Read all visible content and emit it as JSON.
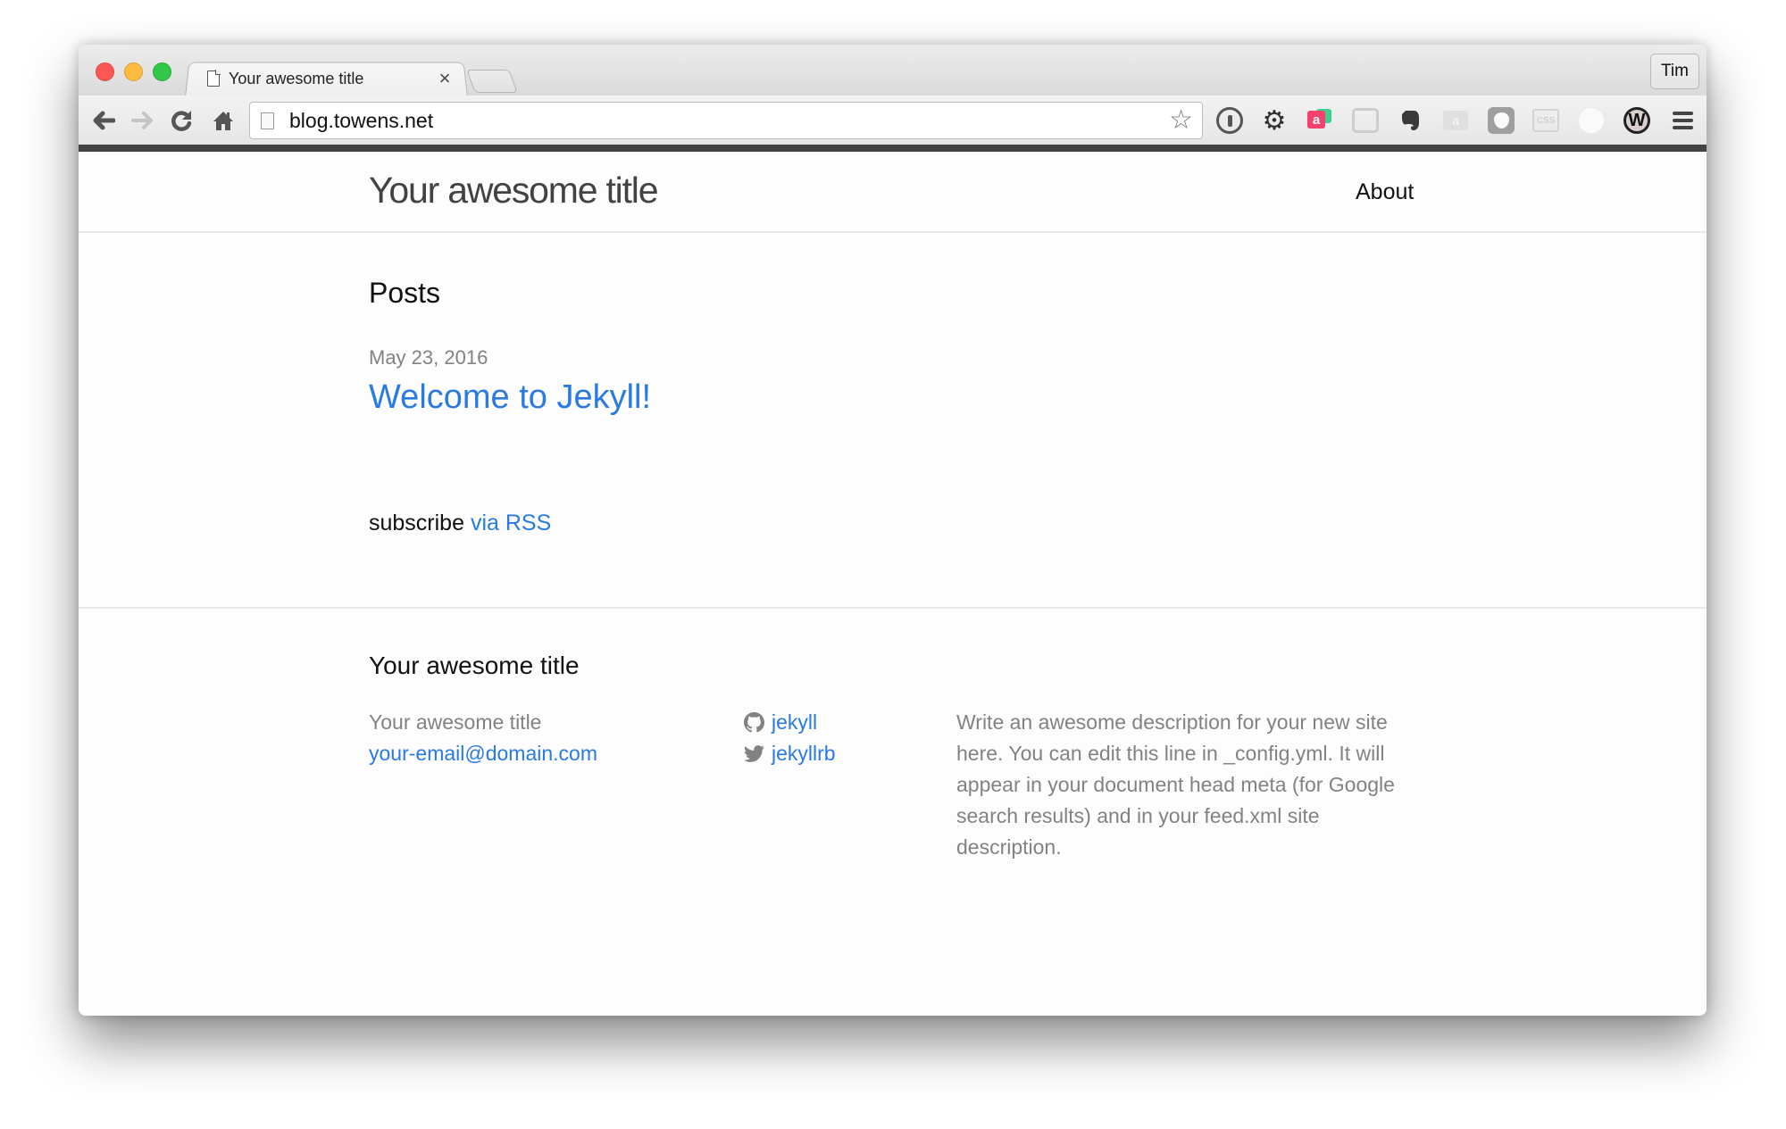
{
  "browser": {
    "tab": {
      "title": "Your awesome title",
      "close_icon": "×"
    },
    "profile": {
      "name": "Tim"
    },
    "toolbar": {
      "back_icon": "🡐",
      "forward_icon": "🡒",
      "reload_icon": "↻",
      "home_icon": "⌂",
      "url": "blog.towens.net",
      "star_icon": "☆",
      "extensions": [
        {
          "name": "1password"
        },
        {
          "name": "settings-gear",
          "glyph": "⚙"
        },
        {
          "name": "airtime",
          "glyph": "a"
        },
        {
          "name": "chat"
        },
        {
          "name": "evernote",
          "glyph": "🐘"
        },
        {
          "name": "airtime-disabled",
          "glyph": "a"
        },
        {
          "name": "shield"
        },
        {
          "name": "css-validator",
          "glyph": "CSS"
        },
        {
          "name": "page-reader"
        },
        {
          "name": "w-extension",
          "glyph": "W"
        },
        {
          "name": "chrome-menu"
        }
      ]
    }
  },
  "site": {
    "header": {
      "title": "Your awesome title",
      "nav": [
        {
          "label": "About"
        }
      ]
    },
    "main": {
      "posts_heading": "Posts",
      "posts": [
        {
          "date": "May 23, 2016",
          "title": "Welcome to Jekyll!"
        }
      ],
      "subscribe_text": "subscribe",
      "subscribe_link": "via RSS"
    },
    "footer": {
      "heading": "Your awesome title",
      "name": "Your awesome title",
      "email": "your-email@domain.com",
      "social": [
        {
          "icon": "github-icon",
          "label": "jekyll"
        },
        {
          "icon": "twitter-icon",
          "label": "jekyllrb"
        }
      ],
      "description": "Write an awesome description for your new site here. You can edit this line in _config.yml. It will appear in your document head meta (for Google search results) and in your feed.xml site description."
    },
    "colors": {
      "link": "#2a7ae2",
      "muted_text": "#828282",
      "text": "#111111",
      "border": "#e8e8e8"
    }
  }
}
